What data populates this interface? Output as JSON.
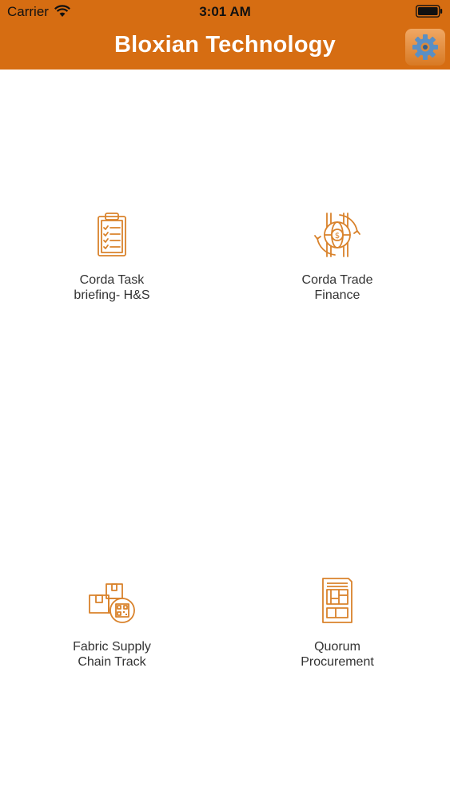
{
  "status_bar": {
    "carrier": "Carrier",
    "time": "3:01 AM"
  },
  "nav": {
    "title": "Bloxian Technology",
    "settings_icon": "gear-icon"
  },
  "colors": {
    "accent": "#d66d12",
    "icon": "#d9822b"
  },
  "tiles": [
    {
      "label": "Corda Task\nbriefing- H&S",
      "icon": "clipboard-checklist-icon"
    },
    {
      "label": "Corda Trade\nFinance",
      "icon": "globe-dollar-exchange-icon"
    },
    {
      "label": "Fabric Supply\nChain Track",
      "icon": "boxes-qr-code-icon"
    },
    {
      "label": "Quorum\nProcurement",
      "icon": "document-form-icon"
    }
  ]
}
